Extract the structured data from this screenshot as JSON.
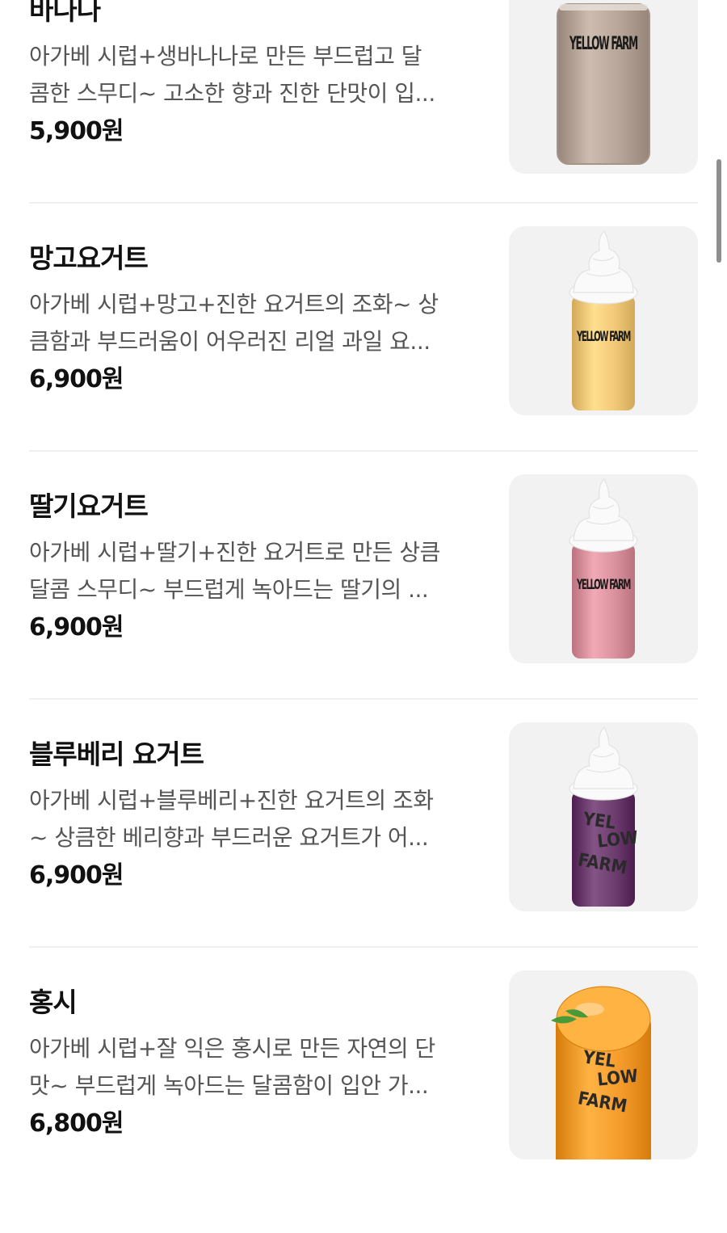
{
  "menu": {
    "items": [
      {
        "name": "바나나",
        "description_lines": [
          "아가베 시럽+생바나나로 만든 부드럽고 달",
          "콤한 스무디~ 고소한 향과 진한 단맛이 입..."
        ],
        "price": "5,900원",
        "image": {
          "icon": "smoothie-cup-icon",
          "brand": "YELLOW FARM",
          "drink_color": "#b4a396",
          "topping": "none",
          "logo_style": "straight"
        }
      },
      {
        "name": "망고요거트",
        "description_lines": [
          "아가베 시럽+망고+진한 요거트의 조화~ 상",
          "큼함과 부드러움이 어우러진 리얼 과일 요..."
        ],
        "price": "6,900원",
        "image": {
          "icon": "smoothie-cup-icon",
          "brand": "YELLOW FARM",
          "drink_color": "#f0c777",
          "topping": "whipped-cream",
          "logo_style": "straight"
        }
      },
      {
        "name": "딸기요거트",
        "description_lines": [
          "아가베 시럽+딸기+진한 요거트로 만든 상큼",
          "달콤 스무디~ 부드럽게 녹아드는 딸기의 ..."
        ],
        "price": "6,900원",
        "image": {
          "icon": "smoothie-cup-icon",
          "brand": "YELLOW FARM",
          "drink_color": "#d9909d",
          "topping": "whipped-cream",
          "logo_style": "straight"
        }
      },
      {
        "name": "블루베리 요거트",
        "description_lines": [
          "아가베 시럽+블루베리+진한 요거트의 조화",
          "~ 상큼한 베리향과 부드러운 요거트가 어..."
        ],
        "price": "6,900원",
        "image": {
          "icon": "smoothie-cup-icon",
          "brand": "YELLOW FARM",
          "drink_color": "#6a3b6c",
          "topping": "whipped-cream",
          "logo_style": "scattered"
        }
      },
      {
        "name": "홍시",
        "description_lines": [
          "아가베 시럽+잘 익은 홍시로 만든 자연의 단",
          "맛~ 부드럽게 녹아드는 달콤함이 입안 가..."
        ],
        "price": "6,800원",
        "image": {
          "icon": "smoothie-cup-icon",
          "brand": "YELLOW FARM",
          "drink_color": "#f39a2a",
          "topping": "persimmon-dome",
          "logo_style": "scattered"
        }
      }
    ]
  },
  "colors": {
    "price": "#111111",
    "description": "#555555",
    "divider": "#efefef",
    "thumb_bg": "#f2f2f2"
  }
}
